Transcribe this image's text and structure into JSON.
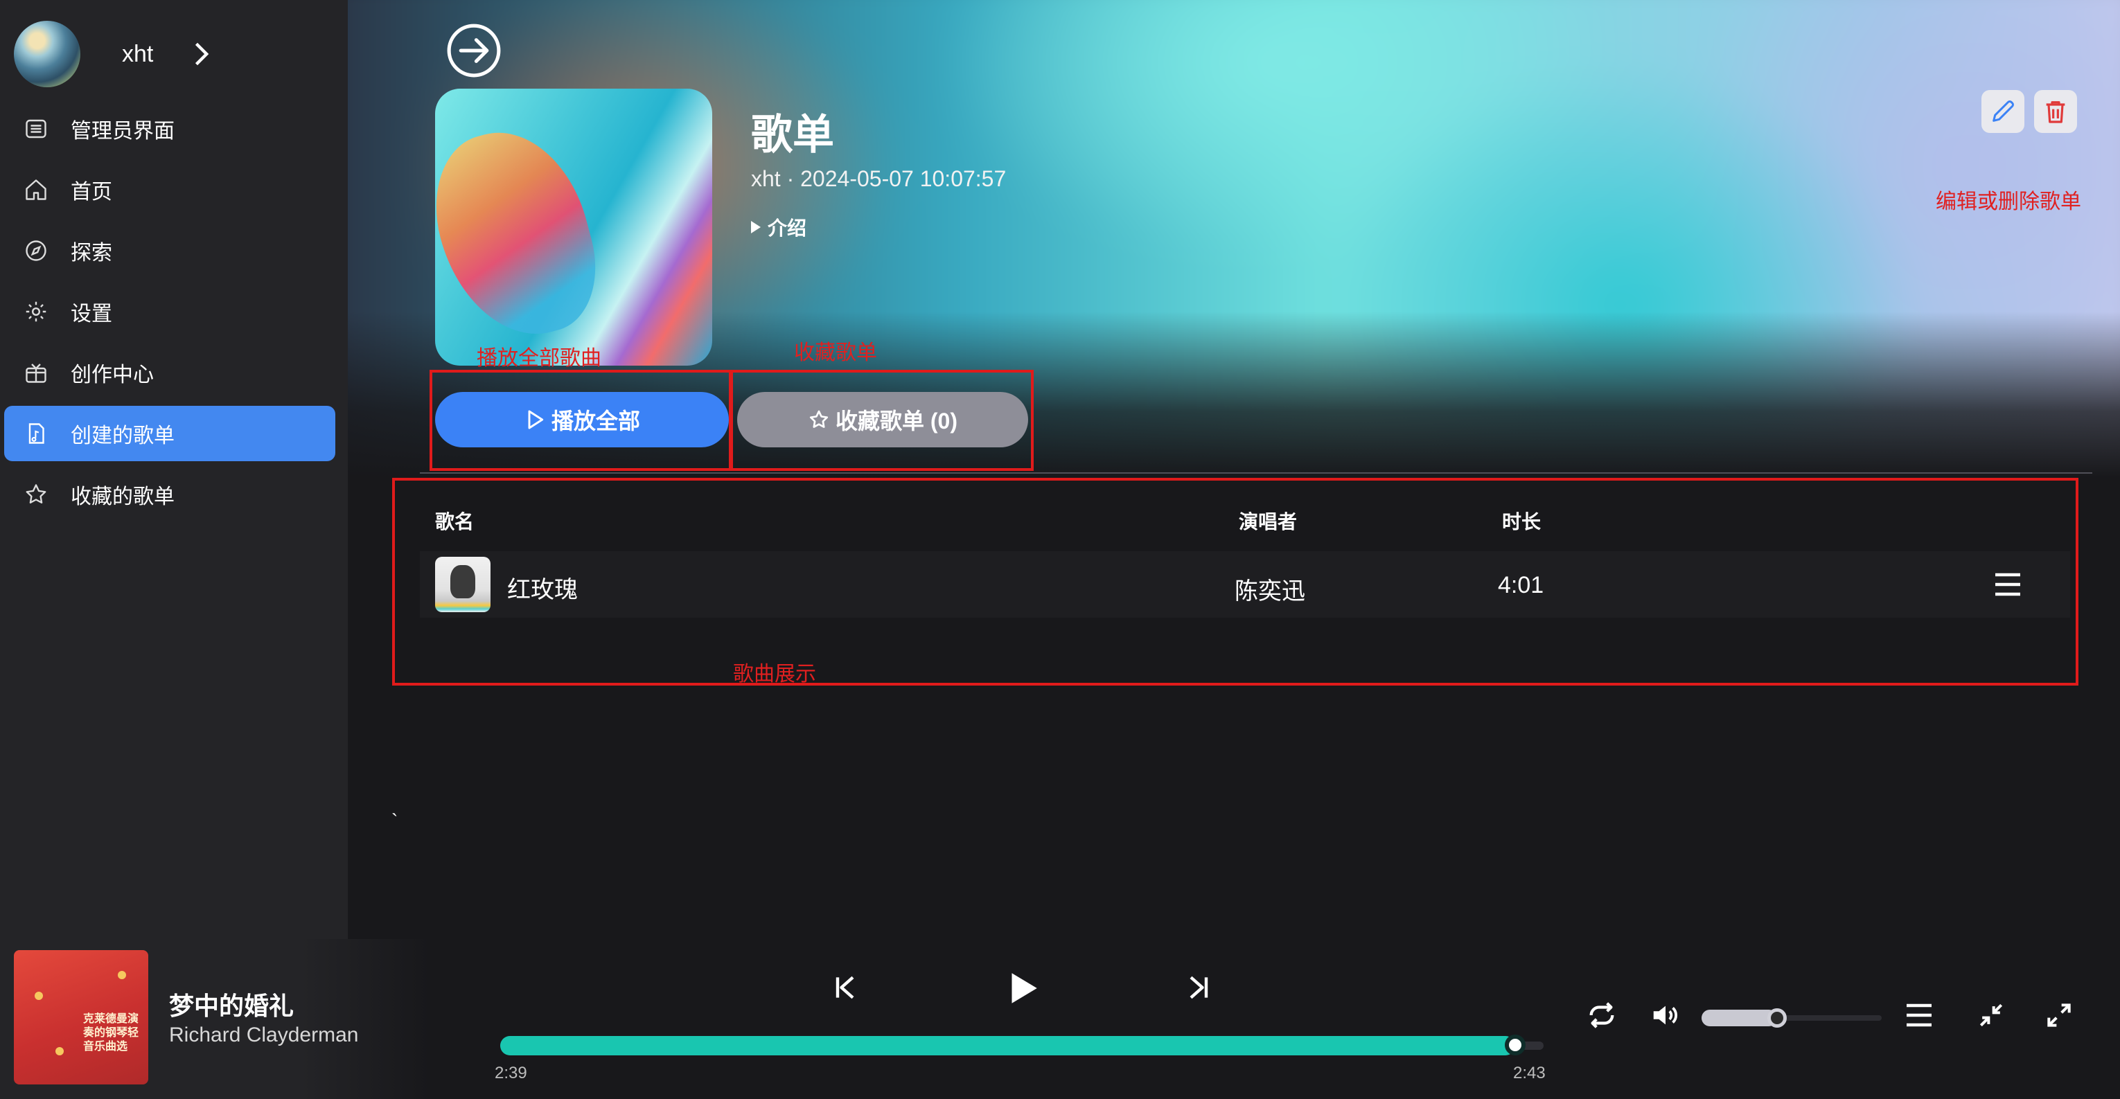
{
  "user": {
    "name": "xht"
  },
  "sidebar": {
    "items": [
      {
        "label": "管理员界面",
        "icon": "admin-list-icon"
      },
      {
        "label": "首页",
        "icon": "home-icon"
      },
      {
        "label": "探索",
        "icon": "compass-icon"
      },
      {
        "label": "设置",
        "icon": "gear-icon"
      },
      {
        "label": "创作中心",
        "icon": "creator-icon"
      },
      {
        "label": "创建的歌单",
        "icon": "playlist-doc-icon",
        "active": true
      },
      {
        "label": "收藏的歌单",
        "icon": "star-icon"
      }
    ]
  },
  "playlist": {
    "title": "歌单",
    "meta": "xht · 2024-05-07 10:07:57",
    "intro_label": "介绍",
    "play_all_label": "播放全部",
    "collect_label": "收藏歌单 (0)"
  },
  "annotations": {
    "play_all": "播放全部歌曲",
    "collect": "收藏歌单",
    "edit_delete": "编辑或删除歌单",
    "songs": "歌曲展示"
  },
  "table": {
    "headers": {
      "name": "歌名",
      "artist": "演唱者",
      "duration": "时长"
    },
    "rows": [
      {
        "name": "红玫瑰",
        "artist": "陈奕迅",
        "duration": "4:01"
      }
    ]
  },
  "stray_mark": "`",
  "player": {
    "title": "梦中的婚礼",
    "artist": "Richard Clayderman",
    "cover_text": "克莱德曼演奏的钢琴轻音乐曲选",
    "current_time": "2:39",
    "total_time": "2:43",
    "progress": 0.973,
    "volume": 0.42
  },
  "colors": {
    "accent": "#3b82f6",
    "progress": "#19c6b0",
    "annotation": "#e01b1b",
    "sidebar_bg": "#242427",
    "main_bg": "#18181b"
  }
}
